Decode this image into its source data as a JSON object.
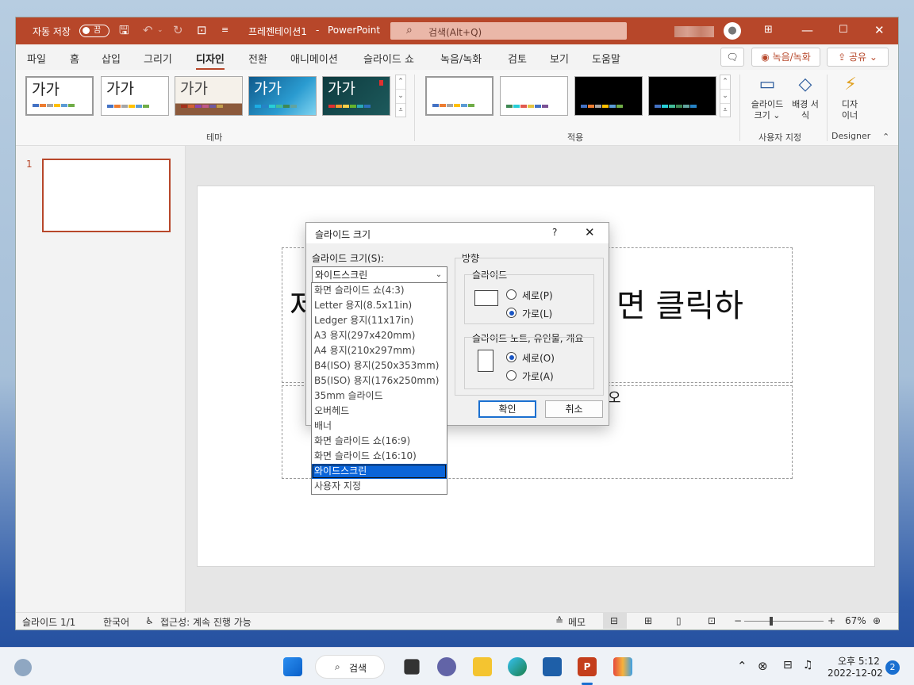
{
  "title_bar": {
    "autosave_label": "자동 저장",
    "autosave_state": "끔",
    "document_name": "프레젠테이션1",
    "separator": "-",
    "app_name": "PowerPoint",
    "search_placeholder": "검색(Alt+Q)"
  },
  "menu": {
    "tabs": [
      "파일",
      "홈",
      "삽입",
      "그리기",
      "디자인",
      "전환",
      "애니메이션",
      "슬라이드 쇼",
      "녹음/녹화",
      "검토",
      "보기",
      "도움말"
    ],
    "active_tab": "디자인",
    "record_button": "녹음/녹화",
    "share_button": "공유"
  },
  "ribbon": {
    "themes_label": "테마",
    "theme_sample_text": "가가",
    "variants_label": "적용",
    "slide_size_button": "슬라이드 크기",
    "background_format_button": "배경 서식",
    "customize_label": "사용자 지정",
    "designer_button": "디자이너",
    "designer_label": "Designer"
  },
  "slides_pane": {
    "slide_number": "1"
  },
  "slide": {
    "title_placeholder_left": "제",
    "title_placeholder_right": "면 클릭하",
    "subtitle_placeholder_right": "오"
  },
  "dialog": {
    "title": "슬라이드 크기",
    "help": "?",
    "size_label": "슬라이드 크기(S):",
    "size_value": "와이드스크린",
    "orientation_label": "방향",
    "slides_group": "슬라이드",
    "slides_portrait": "세로(P)",
    "slides_landscape": "가로(L)",
    "slides_selected": "landscape",
    "notes_group": "슬라이드 노트, 유인물, 개요",
    "notes_portrait": "세로(O)",
    "notes_landscape": "가로(A)",
    "notes_selected": "portrait",
    "ok_button": "확인",
    "cancel_button": "취소"
  },
  "size_options": [
    "화면 슬라이드 쇼(4:3)",
    "Letter 용지(8.5x11in)",
    "Ledger 용지(11x17in)",
    "A3 용지(297x420mm)",
    "A4 용지(210x297mm)",
    "B4(ISO) 용지(250x353mm)",
    "B5(ISO) 용지(176x250mm)",
    "35mm 슬라이드",
    "오버헤드",
    "배너",
    "화면 슬라이드 쇼(16:9)",
    "화면 슬라이드 쇼(16:10)",
    "와이드스크린",
    "사용자 지정"
  ],
  "status_bar": {
    "slide_info": "슬라이드 1/1",
    "language": "한국어",
    "accessibility": "접근성: 계속 진행 가능",
    "notes_button": "메모",
    "zoom": "67%"
  },
  "taskbar": {
    "search_label": "검색",
    "time": "오후 5:12",
    "date": "2022-12-02",
    "notification_count": "2"
  },
  "colors": {
    "accent": "#b7472a",
    "selection": "#0a64d8"
  }
}
